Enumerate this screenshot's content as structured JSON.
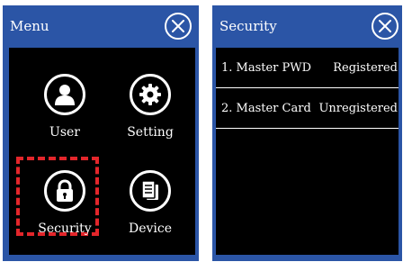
{
  "menu": {
    "title": "Menu",
    "close_icon": "close-icon",
    "tiles": [
      {
        "label": "User",
        "icon": "user-icon"
      },
      {
        "label": "Setting",
        "icon": "gear-icon"
      },
      {
        "label": "Security",
        "icon": "lock-icon",
        "highlighted": true
      },
      {
        "label": "Device",
        "icon": "device-icon"
      }
    ]
  },
  "security": {
    "title": "Security",
    "close_icon": "close-icon",
    "rows": [
      {
        "label": "1. Master PWD",
        "value": "Registered"
      },
      {
        "label": "2. Master Card",
        "value": "Unregistered"
      }
    ]
  },
  "colors": {
    "panel": "#2b55a6",
    "screen": "#000000",
    "highlight": "#e3262b"
  }
}
